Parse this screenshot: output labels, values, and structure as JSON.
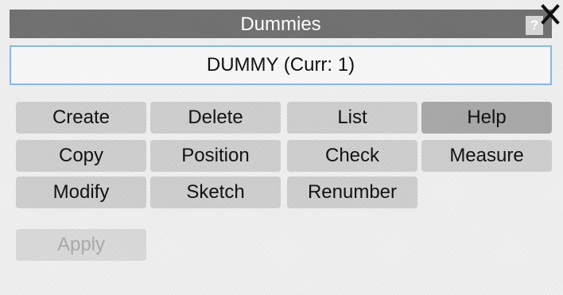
{
  "window": {
    "title": "Dummies",
    "help_glyph": "?"
  },
  "current": {
    "label": "DUMMY (Curr: 1)"
  },
  "buttons": {
    "create": "Create",
    "delete": "Delete",
    "list": "List",
    "help": "Help",
    "copy": "Copy",
    "position": "Position",
    "check": "Check",
    "measure": "Measure",
    "modify": "Modify",
    "sketch": "Sketch",
    "renumber": "Renumber",
    "apply": "Apply"
  },
  "colors": {
    "titlebar": "#6e6e6e",
    "background": "#f1f1f1",
    "button": "#cfcfcf",
    "button_active": "#a8a8a8",
    "field_border": "#87b7e8"
  },
  "icons": {
    "close": "close-icon",
    "help": "question-icon"
  }
}
